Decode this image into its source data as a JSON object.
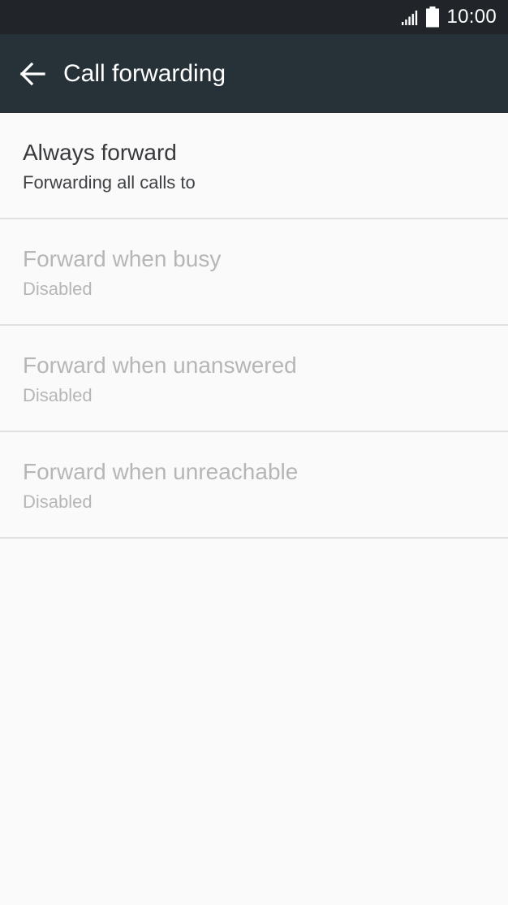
{
  "status_bar": {
    "time": "10:00",
    "signal_icon": "signal-strength-icon",
    "battery_icon": "battery-full-icon"
  },
  "app_bar": {
    "back_icon": "arrow-left-icon",
    "title": "Call forwarding",
    "background": "#263238"
  },
  "settings": [
    {
      "title": "Always forward",
      "summary": "Forwarding all calls to",
      "enabled": true
    },
    {
      "title": "Forward when busy",
      "summary": "Disabled",
      "enabled": false
    },
    {
      "title": "Forward when unanswered",
      "summary": "Disabled",
      "enabled": false
    },
    {
      "title": "Forward when unreachable",
      "summary": "Disabled",
      "enabled": false
    }
  ],
  "colors": {
    "status_bar": "#212529",
    "page_background": "#fafafa",
    "disabled_text": "#b6b6b6",
    "divider": "#e0e0e0"
  }
}
